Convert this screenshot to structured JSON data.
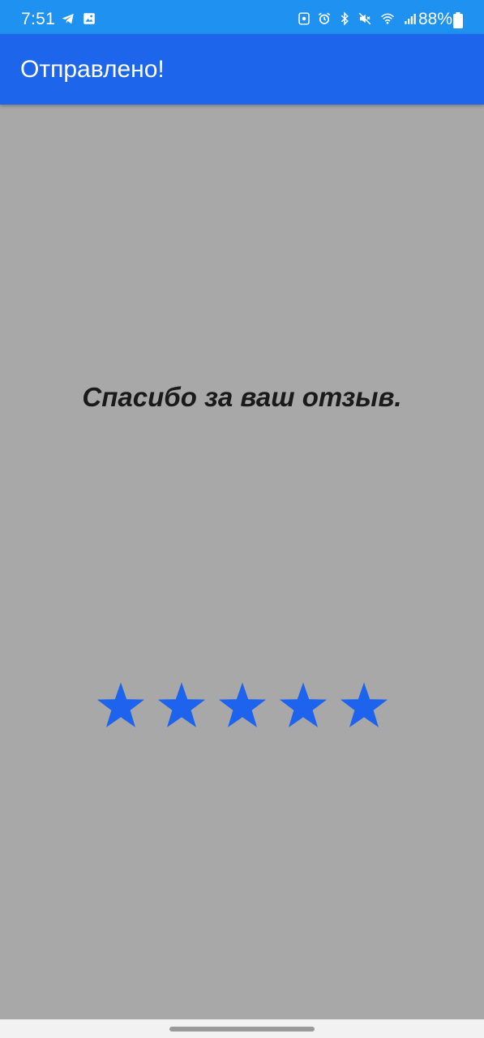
{
  "status_bar": {
    "time": "7:51",
    "left_icons": [
      "telegram-icon",
      "image-icon"
    ],
    "right_icons": [
      "screenshot-icon",
      "alarm-icon",
      "bluetooth-icon",
      "mute-icon",
      "wifi-icon",
      "signal-icon"
    ],
    "battery_percent": "88%",
    "background_color": "#1f91f0"
  },
  "app_bar": {
    "title": "Отправлено!",
    "background_color": "#1d66ec"
  },
  "main": {
    "message": "Спасибо за ваш отзыв.",
    "background_color": "#a8a8a8"
  },
  "rating": {
    "value": 5,
    "max": 5,
    "star_color": "#1e63ee"
  }
}
